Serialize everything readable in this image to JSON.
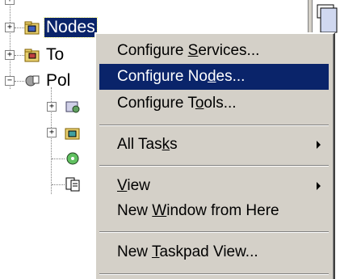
{
  "tree": {
    "items": [
      {
        "label": "Nodes",
        "selected": true,
        "icon": "nodes-folder-icon"
      },
      {
        "label": "To",
        "icon": "tools-folder-icon"
      },
      {
        "label": "Pol",
        "icon": "policies-icon"
      }
    ]
  },
  "context_menu": {
    "items": [
      {
        "pre": "Configure ",
        "acc": "S",
        "post": "ervices...",
        "highlighted": false,
        "submenu": false
      },
      {
        "pre": "Configure No",
        "acc": "d",
        "post": "es...",
        "highlighted": true,
        "submenu": false
      },
      {
        "pre": "Configure T",
        "acc": "o",
        "post": "ols...",
        "highlighted": false,
        "submenu": false
      },
      {
        "pre": "All Tas",
        "acc": "k",
        "post": "s",
        "highlighted": false,
        "submenu": true
      },
      {
        "pre": "",
        "acc": "V",
        "post": "iew",
        "highlighted": false,
        "submenu": true
      },
      {
        "pre": "New ",
        "acc": "W",
        "post": "indow from Here",
        "highlighted": false,
        "submenu": false
      },
      {
        "pre": "New ",
        "acc": "T",
        "post": "askpad View...",
        "highlighted": false,
        "submenu": false
      }
    ]
  },
  "colors": {
    "menu_bg": "#d4d0c8",
    "highlight": "#0a246a"
  }
}
